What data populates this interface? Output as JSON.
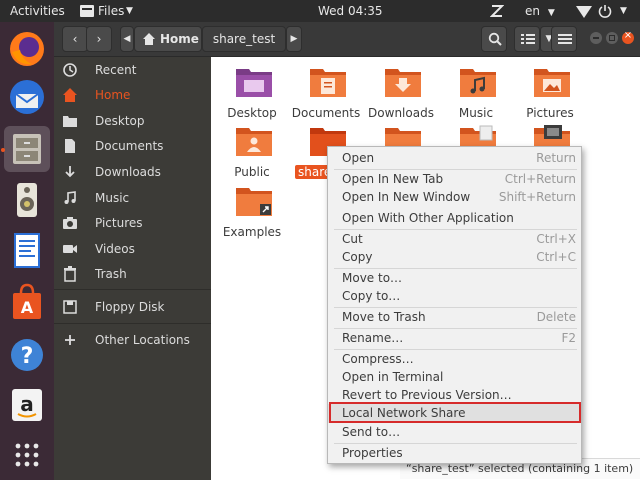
{
  "topbar": {
    "activities": "Activities",
    "app_name": "Files",
    "clock": "Wed 04:35",
    "language": "en"
  },
  "header": {
    "location_home": "Home",
    "location_current": "share_test"
  },
  "sidebar": {
    "items": [
      {
        "label": "Recent",
        "icon": "clock-icon"
      },
      {
        "label": "Home",
        "icon": "home-icon",
        "active": true
      },
      {
        "label": "Desktop",
        "icon": "desktop-folder-icon"
      },
      {
        "label": "Documents",
        "icon": "document-icon"
      },
      {
        "label": "Downloads",
        "icon": "download-icon"
      },
      {
        "label": "Music",
        "icon": "music-icon"
      },
      {
        "label": "Pictures",
        "icon": "camera-icon"
      },
      {
        "label": "Videos",
        "icon": "video-icon"
      },
      {
        "label": "Trash",
        "icon": "trash-icon"
      },
      {
        "label": "Floppy Disk",
        "icon": "floppy-icon"
      },
      {
        "label": "Other Locations",
        "icon": "plus-icon"
      }
    ]
  },
  "files": [
    {
      "label": "Desktop",
      "icon": "desktop-folder-icon"
    },
    {
      "label": "Documents",
      "icon": "documents-folder-icon"
    },
    {
      "label": "Downloads",
      "icon": "downloads-folder-icon"
    },
    {
      "label": "Music",
      "icon": "music-folder-icon"
    },
    {
      "label": "Pictures",
      "icon": "pictures-folder-icon"
    },
    {
      "label": "Public",
      "icon": "public-folder-icon"
    },
    {
      "label": "share",
      "icon": "share-folder-icon",
      "selected": true
    },
    {
      "label": "",
      "icon": "templates-folder-icon"
    },
    {
      "label": "",
      "icon": "text-folder-icon"
    },
    {
      "label": "",
      "icon": "videos-folder-icon"
    },
    {
      "label": "Examples",
      "icon": "examples-folder-icon"
    }
  ],
  "context_menu": {
    "items": [
      {
        "label": "Open",
        "shortcut": "Return"
      },
      {
        "label": "Open In New Tab",
        "shortcut": "Ctrl+Return"
      },
      {
        "label": "Open In New Window",
        "shortcut": "Shift+Return"
      },
      {
        "label": "Open With Other Application",
        "shortcut": ""
      },
      {
        "label": "Cut",
        "shortcut": "Ctrl+X"
      },
      {
        "label": "Copy",
        "shortcut": "Ctrl+C"
      },
      {
        "label": "Move to…",
        "shortcut": ""
      },
      {
        "label": "Copy to…",
        "shortcut": ""
      },
      {
        "label": "Move to Trash",
        "shortcut": "Delete"
      },
      {
        "label": "Rename…",
        "shortcut": "F2"
      },
      {
        "label": "Compress…",
        "shortcut": ""
      },
      {
        "label": "Open in Terminal",
        "shortcut": ""
      },
      {
        "label": "Revert to Previous Version…",
        "shortcut": ""
      },
      {
        "label": "Local Network Share",
        "shortcut": "",
        "highlighted": true
      },
      {
        "label": "Send to…",
        "shortcut": ""
      },
      {
        "label": "Properties",
        "shortcut": ""
      }
    ]
  },
  "status": {
    "text": "“share_test” selected  (containing 1 item)"
  },
  "colors": {
    "accent": "#e95420",
    "highlight_border": "#d62b2b"
  }
}
